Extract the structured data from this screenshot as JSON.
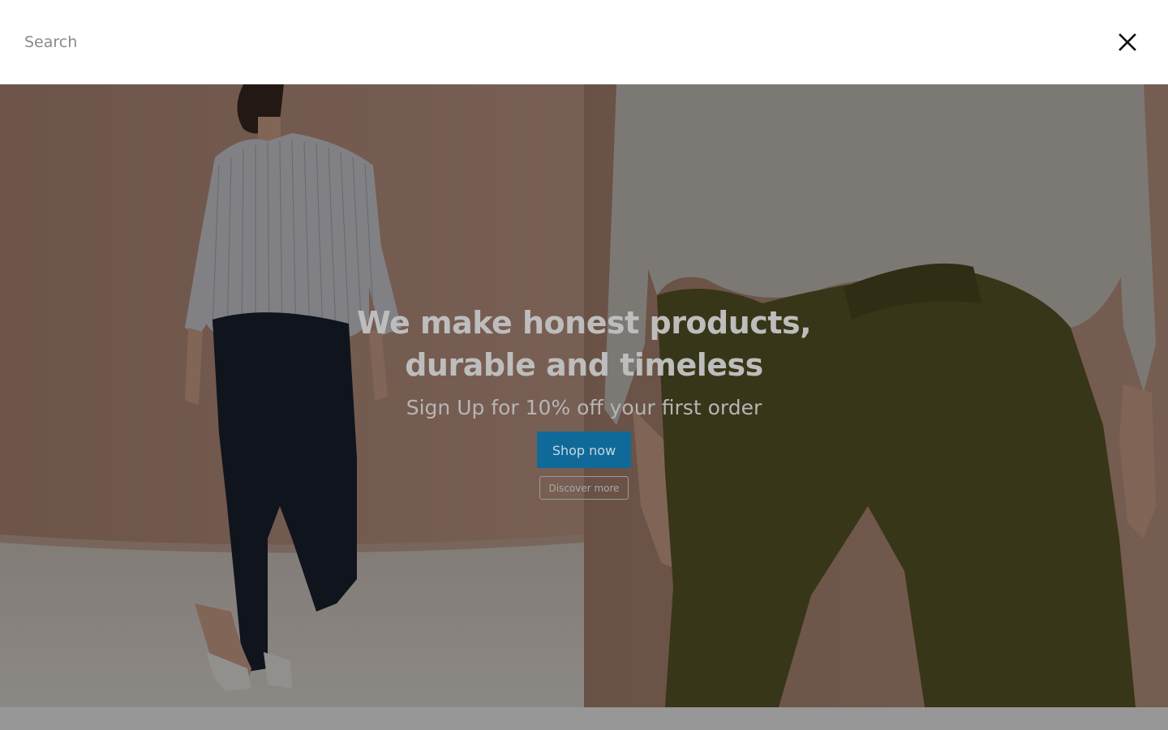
{
  "search": {
    "placeholder": "Search",
    "value": ""
  },
  "close_icon": "close-x-icon",
  "hero": {
    "headline": "We make honest products, durable and timeless",
    "subheadline": "Sign Up for 10% off your first order",
    "primary_button_label": "Shop now",
    "secondary_button_label": "Discover more",
    "primary_button_color": "#1a7ab4",
    "overlay_color": "rgba(0,0,0,0.4)",
    "left_image": "woman in striped shirt, navy pants and white mules",
    "right_image": "woman in grey sweater and olive pants"
  }
}
